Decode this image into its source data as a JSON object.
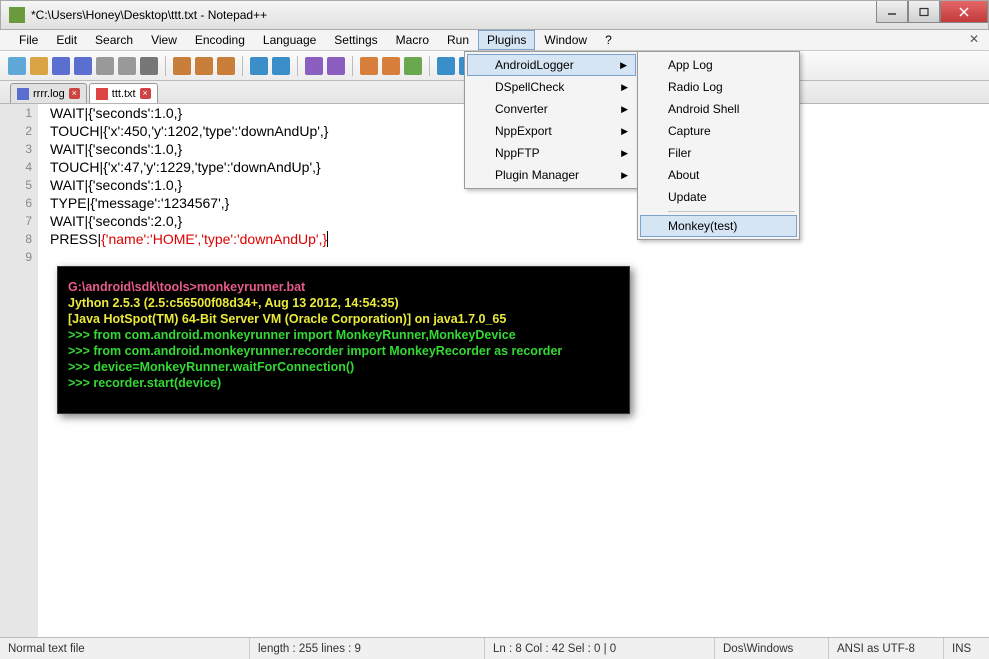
{
  "title": "*C:\\Users\\Honey\\Desktop\\ttt.txt - Notepad++",
  "menu": [
    "File",
    "Edit",
    "Search",
    "View",
    "Encoding",
    "Language",
    "Settings",
    "Macro",
    "Run",
    "Plugins",
    "Window",
    "?"
  ],
  "menu_active": "Plugins",
  "tabs": [
    {
      "name": "rrrr.log",
      "active": false
    },
    {
      "name": "ttt.txt",
      "active": true
    }
  ],
  "code": [
    "WAIT|{'seconds':1.0,}",
    "TOUCH|{'x':450,'y':1202,'type':'downAndUp',}",
    "WAIT|{'seconds':1.0,}",
    "TOUCH|{'x':47,'y':1229,'type':'downAndUp',}",
    "WAIT|{'seconds':1.0,}",
    "TYPE|{'message':'1234567',}",
    "WAIT|{'seconds':2.0,}"
  ],
  "code_line8_head": "PRESS|",
  "code_line8_red": "{'name':'HOME','type':'downAndUp',}",
  "line_count": 9,
  "plugins_menu": [
    {
      "label": "AndroidLogger",
      "sub": true,
      "hl": true
    },
    {
      "label": "DSpellCheck",
      "sub": true
    },
    {
      "label": "Converter",
      "sub": true
    },
    {
      "label": "NppExport",
      "sub": true
    },
    {
      "label": "NppFTP",
      "sub": true
    },
    {
      "label": "Plugin Manager",
      "sub": true
    }
  ],
  "android_submenu": [
    {
      "label": "App Log"
    },
    {
      "label": "Radio Log"
    },
    {
      "label": "Android Shell"
    },
    {
      "label": "Capture"
    },
    {
      "label": "Filer"
    },
    {
      "label": "About"
    },
    {
      "label": "Update"
    },
    {
      "label": "Monkey(test)",
      "hl": true
    }
  ],
  "console": [
    {
      "cls": "ln-r",
      "t": "G:\\android\\sdk\\tools>monkeyrunner.bat"
    },
    {
      "cls": "ln-y",
      "t": "Jython 2.5.3 (2.5:c56500f08d34+, Aug 13 2012, 14:54:35)"
    },
    {
      "cls": "ln-y",
      "t": "[Java HotSpot(TM) 64-Bit Server VM (Oracle Corporation)] on java1.7.0_65"
    },
    {
      "cls": "ln-g",
      "t": ">>> from com.android.monkeyrunner import MonkeyRunner,MonkeyDevice"
    },
    {
      "cls": "ln-g",
      "t": ">>> from com.android.monkeyrunner.recorder import MonkeyRecorder as recorder"
    },
    {
      "cls": "ln-g",
      "t": ">>> device=MonkeyRunner.waitForConnection()"
    },
    {
      "cls": "ln-g",
      "t": ">>> recorder.start(device)"
    }
  ],
  "status": {
    "filetype": "Normal text file",
    "length": "length : 255    lines : 9",
    "pos": "Ln : 8    Col : 42    Sel : 0 | 0",
    "eol": "Dos\\Windows",
    "enc": "ANSI as UTF-8",
    "mode": "INS"
  },
  "toolbar_icons": [
    "new",
    "open",
    "save",
    "saveall",
    "close",
    "closeall",
    "print",
    "",
    "cut",
    "copy",
    "paste",
    "",
    "undo",
    "redo",
    "",
    "find",
    "replace",
    "",
    "wrap",
    "chars",
    "indent",
    "",
    "zoom1",
    "zoom2",
    "sync1",
    "sync2",
    "",
    "fold",
    "unfold",
    "hidden",
    "",
    "macro-rec",
    "macro-play",
    "macro-mplay",
    "macro-save",
    "spell",
    "doclist"
  ],
  "tb_colors": [
    "#5fa9d8",
    "#d9a544",
    "#5a6fd0",
    "#5a6fd0",
    "#999",
    "#999",
    "#777",
    "|",
    "#c97f3a",
    "#c97f3a",
    "#c97f3a",
    "|",
    "#3a8fc9",
    "#3a8fc9",
    "|",
    "#8a5fbf",
    "#8a5fbf",
    "|",
    "#d77e3a",
    "#d77e3a",
    "#6aa84f",
    "|",
    "#3a8fc9",
    "#3a8fc9",
    "#3a8fc9",
    "#3a8fc9",
    "|",
    "#888",
    "#888",
    "#888",
    "|",
    "#c94f4f",
    "#4f9ac9",
    "#4f9ac9",
    "#555",
    "#c94f4f",
    "#c9a14f"
  ]
}
